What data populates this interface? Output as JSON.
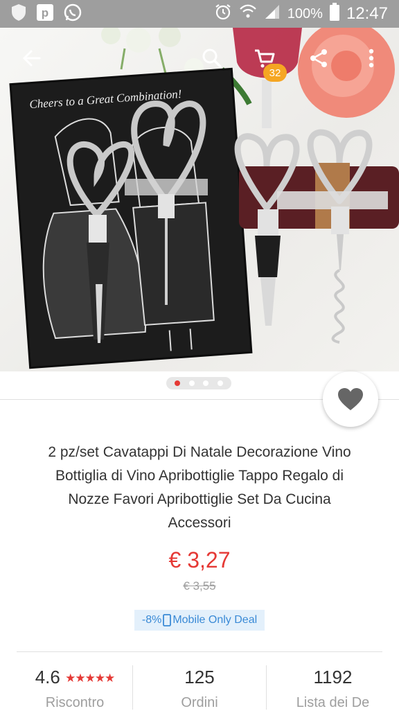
{
  "status_bar": {
    "battery": "100%",
    "time": "12:47"
  },
  "toolbar": {
    "cart_count": "32"
  },
  "hero": {
    "box_caption": "Cheers to a Great Combination!"
  },
  "product": {
    "title_lines": [
      "2 pz/set Cavatappi Di Natale Decorazione Vino",
      "Bottiglia di Vino Apribottiglie Tappo Regalo di",
      "Nozze Favori Apribottiglie Set Da Cucina",
      "Accessori"
    ],
    "price": "€ 3,27",
    "old_price": "€ 3,55",
    "deal_percent": "-8%",
    "deal_label": "Mobile Only Deal"
  },
  "stats": {
    "rating_value": "4.6",
    "rating_stars": "★★★★★",
    "rating_label": "Riscontro",
    "orders_value": "125",
    "orders_label": "Ordini",
    "wishlist_value": "1192",
    "wishlist_label": "Lista dei De"
  },
  "colors": {
    "accent": "#e53935",
    "badge": "#f5a623",
    "deal_text": "#3a8ad6",
    "deal_bg": "#e3f0fb"
  }
}
